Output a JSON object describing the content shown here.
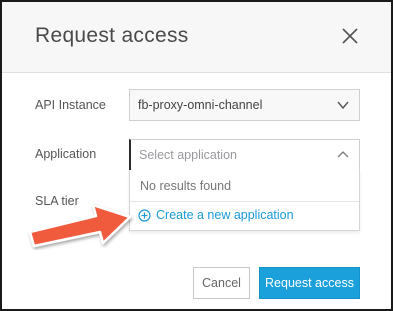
{
  "dialog": {
    "title": "Request access",
    "close_icon": "close-icon"
  },
  "form": {
    "api_instance": {
      "label": "API Instance",
      "value": "fb-proxy-omni-channel",
      "icon": "chevron-down-icon"
    },
    "application": {
      "label": "Application",
      "placeholder": "Select application",
      "icon": "chevron-up-icon"
    },
    "sla_tier": {
      "label": "SLA tier"
    }
  },
  "dropdown": {
    "empty_text": "No results found",
    "create_link": "Create a new application",
    "create_icon": "plus-circle-icon"
  },
  "footer": {
    "cancel_label": "Cancel",
    "submit_label": "Request access"
  },
  "annotation": {
    "arrow_icon": "arrow-pointer-icon",
    "arrow_color": "#f05a3c"
  },
  "colors": {
    "primary": "#1ba0db",
    "link": "#1a9ad6",
    "header_bg": "#f7f7f8"
  }
}
